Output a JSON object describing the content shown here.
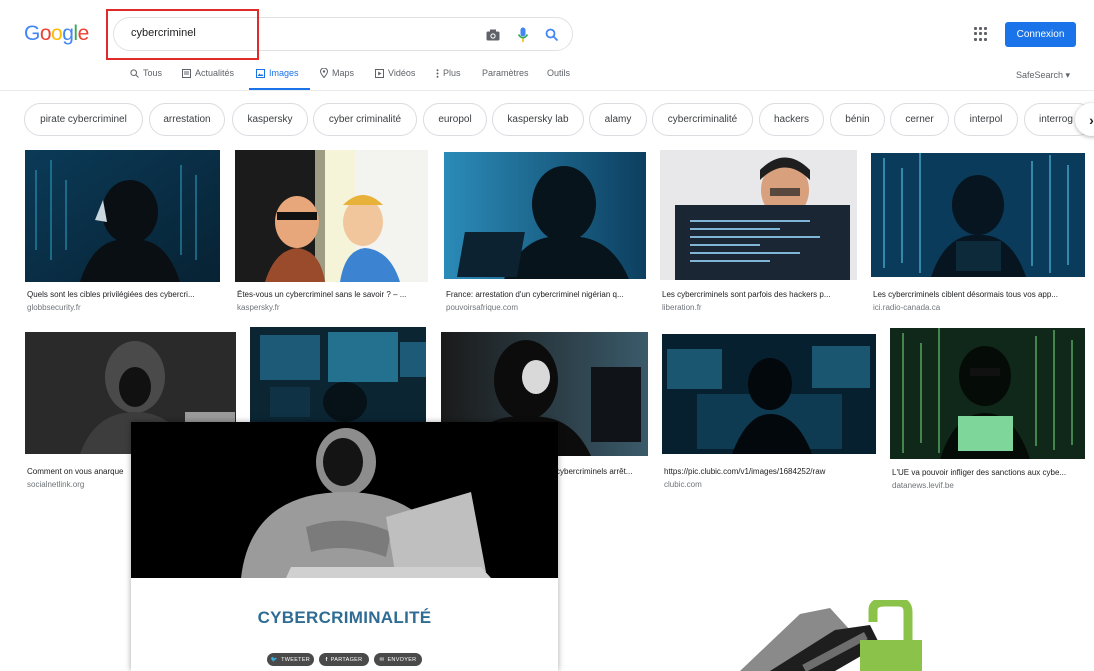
{
  "header": {
    "logo_text": "Google",
    "search_value": "cybercriminel",
    "login_label": "Connexion"
  },
  "tabs": [
    {
      "label": "Tous",
      "icon": "search-icon"
    },
    {
      "label": "Actualités",
      "icon": "news-icon"
    },
    {
      "label": "Images",
      "icon": "image-icon",
      "active": true
    },
    {
      "label": "Maps",
      "icon": "map-pin-icon"
    },
    {
      "label": "Vidéos",
      "icon": "video-icon"
    },
    {
      "label": "Plus",
      "icon": "more-vert-icon"
    },
    {
      "label": "Paramètres"
    },
    {
      "label": "Outils"
    }
  ],
  "safesearch_label": "SafeSearch",
  "chips": [
    "pirate cybercriminel",
    "arrestation",
    "kaspersky",
    "cyber criminalité",
    "europol",
    "kaspersky lab",
    "alamy",
    "cybercriminalité",
    "hackers",
    "bénin",
    "cerner",
    "interpol",
    "interrog"
  ],
  "results_row1": [
    {
      "title": "Quels sont les cibles privilégiées des cybercri...",
      "source": "globbsecurity.fr"
    },
    {
      "title": "Êtes-vous un cybercriminel sans le savoir ? – ...",
      "source": "kaspersky.fr"
    },
    {
      "title": "France: arrestation d'un cybercriminel nigérian q...",
      "source": "pouvoirsafrique.com"
    },
    {
      "title": "Les cybercriminels sont parfois des hackers p...",
      "source": "liberation.fr"
    },
    {
      "title": "Les cybercriminels ciblent désormais tous vos app...",
      "source": "ici.radio-canada.ca"
    }
  ],
  "results_row2": [
    {
      "title": "Comment on vous anarque",
      "source": "socialnetlink.org"
    },
    {
      "title": "",
      "source": ""
    },
    {
      "title": "cybercriminels arrêt...",
      "source": ""
    },
    {
      "title": "https://pic.clubic.com/v1/images/1684252/raw",
      "source": "clubic.com"
    },
    {
      "title": "L'UE va pouvoir infliger des sanctions aux cybe...",
      "source": "datanews.levif.be"
    }
  ],
  "overlay": {
    "heading": "CYBERCRIMINALITÉ",
    "share_buttons": [
      "TWEETER",
      "PARTAGER",
      "ENVOYER"
    ]
  },
  "colors": {
    "accent": "#1a73e8",
    "highlight_box": "#e02a2a",
    "overlay_heading": "#2f6c94"
  }
}
